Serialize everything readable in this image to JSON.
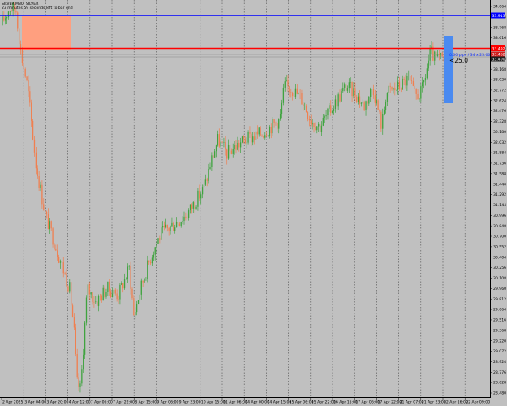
{
  "header": {
    "symbol": "SILVER,M30: SILVER",
    "countdown": "23 minutes 59 seconds left to bar end"
  },
  "colors": {
    "background": "#c0c0c0",
    "bull_candle": "#3fa33f",
    "bear_candle": "#f07f4f",
    "resistance_line": "#0000ff",
    "support_line": "#ff0000",
    "zone_fill": "#ff9f7f",
    "ruler_box": "#4a8af0",
    "grid": "#505050"
  },
  "price_tags": {
    "blue": "33.913",
    "red": "33.492",
    "ask": "33.462",
    "bid": "33.400"
  },
  "ruler": {
    "label": "0.00 pips / 34 x 25.00",
    "value": "<25.0"
  },
  "chart_data": {
    "type": "candlestick",
    "timeframe": "M30",
    "y_axis": {
      "range": [
        28.3,
        34.15
      ],
      "tick_labels": [
        "34.064",
        "33.916",
        "33.768",
        "33.616",
        "33.468",
        "33.316",
        "33.168",
        "33.020",
        "32.772",
        "32.624",
        "32.476",
        "32.328",
        "32.180",
        "32.032",
        "31.884",
        "31.736",
        "31.588",
        "31.440",
        "31.292",
        "31.144",
        "30.996",
        "30.848",
        "30.700",
        "30.552",
        "30.404",
        "30.256",
        "30.108",
        "29.960",
        "29.812",
        "29.664",
        "29.516",
        "29.368",
        "29.220",
        "29.072",
        "28.924",
        "28.776",
        "28.628",
        "28.480"
      ]
    },
    "x_axis": {
      "tick_labels": [
        "2 Apr 2025",
        "3 Apr 04:00",
        "3 Apr 20:00",
        "4 Apr 12:00",
        "7 Apr 06:00",
        "7 Apr 22:00",
        "8 Apr 15:00",
        "9 Apr 06:00",
        "9 Apr 23:00",
        "10 Apr 15:00",
        "11 Apr 06:00",
        "14 Apr 00:00",
        "14 Apr 15:00",
        "15 Apr 06:00",
        "15 Apr 22:00",
        "16 Apr 15:00",
        "17 Apr 06:00",
        "17 Apr 22:00",
        "21 Apr 07:00",
        "21 Apr 23:00",
        "22 Apr 16:00",
        "22 Apr 09:00"
      ]
    },
    "grid": "vertical-dotted",
    "levels": [
      {
        "name": "Resistance",
        "price": 33.913
      },
      {
        "name": "Support",
        "price": 33.492
      }
    ],
    "series": [
      {
        "name": "SILVER M30 close (approx.)",
        "points": [
          [
            0.0,
            33.8
          ],
          [
            0.02,
            34.06
          ],
          [
            0.035,
            34.02
          ],
          [
            0.045,
            33.4
          ],
          [
            0.06,
            32.9
          ],
          [
            0.08,
            31.7
          ],
          [
            0.1,
            31.0
          ],
          [
            0.12,
            30.6
          ],
          [
            0.14,
            30.2
          ],
          [
            0.155,
            29.9
          ],
          [
            0.165,
            29.3
          ],
          [
            0.172,
            28.5
          ],
          [
            0.18,
            28.4
          ],
          [
            0.195,
            29.9
          ],
          [
            0.215,
            29.7
          ],
          [
            0.24,
            29.9
          ],
          [
            0.265,
            29.8
          ],
          [
            0.29,
            30.2
          ],
          [
            0.3,
            29.5
          ],
          [
            0.32,
            30.0
          ],
          [
            0.34,
            30.4
          ],
          [
            0.36,
            30.7
          ],
          [
            0.38,
            30.8
          ],
          [
            0.4,
            30.9
          ],
          [
            0.42,
            31.0
          ],
          [
            0.44,
            31.2
          ],
          [
            0.46,
            31.4
          ],
          [
            0.475,
            31.8
          ],
          [
            0.49,
            32.1
          ],
          [
            0.51,
            31.9
          ],
          [
            0.53,
            32.0
          ],
          [
            0.55,
            32.1
          ],
          [
            0.57,
            32.15
          ],
          [
            0.59,
            32.2
          ],
          [
            0.61,
            32.3
          ],
          [
            0.63,
            32.4
          ],
          [
            0.64,
            32.9
          ],
          [
            0.66,
            32.85
          ],
          [
            0.68,
            32.7
          ],
          [
            0.7,
            32.4
          ],
          [
            0.72,
            32.3
          ],
          [
            0.74,
            32.5
          ],
          [
            0.76,
            32.7
          ],
          [
            0.78,
            32.9
          ],
          [
            0.8,
            32.8
          ],
          [
            0.82,
            32.6
          ],
          [
            0.84,
            32.9
          ],
          [
            0.86,
            32.3
          ],
          [
            0.87,
            32.8
          ],
          [
            0.89,
            32.85
          ],
          [
            0.92,
            33.0
          ],
          [
            0.935,
            32.75
          ],
          [
            0.95,
            32.8
          ],
          [
            0.96,
            33.1
          ],
          [
            0.97,
            33.4
          ],
          [
            0.98,
            33.3
          ]
        ]
      }
    ]
  }
}
